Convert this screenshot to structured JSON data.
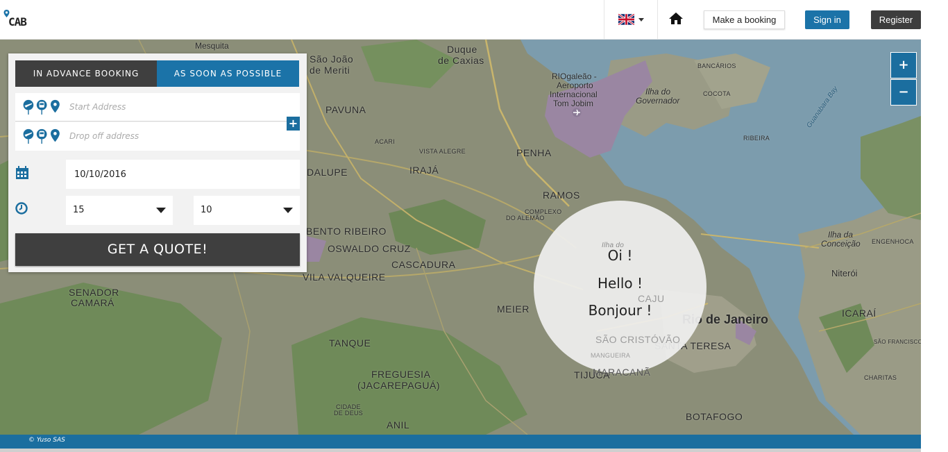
{
  "header": {
    "logo_text": "CAB",
    "language_flag": "uk-flag-icon",
    "home_icon": "home-icon",
    "make_booking_label": "Make a booking",
    "sign_in_label": "Sign in",
    "register_label": "Register",
    "accent_color": "#1b73a8"
  },
  "booking": {
    "tabs": [
      {
        "label": "IN ADVANCE BOOKING",
        "active": false
      },
      {
        "label": "AS SOON AS POSSIBLE",
        "active": true
      }
    ],
    "start_address_placeholder": "Start Address",
    "dropoff_address_placeholder": "Drop off address",
    "address_icons": [
      "plane-icon",
      "train-icon",
      "location-pin-icon"
    ],
    "date_value": "10/10/2016",
    "hour_value": "15",
    "minute_value": "10",
    "quote_label": "GET A QUOTE!"
  },
  "map": {
    "zoom_in_label": "+",
    "zoom_out_label": "−",
    "greetings": [
      "Oi !",
      "Hello !",
      "Bonjour !"
    ],
    "labels": {
      "mesquita": "Mesquita",
      "sao_joao_1": "São João",
      "sao_joao_2": "de Meriti",
      "duque_1": "Duque",
      "duque_2": "de Caxias",
      "galeao_1": "RIOgaleão -",
      "galeao_2": "Aeroporto",
      "galeao_3": "Internacional",
      "galeao_4": "Tom Jobim",
      "ilha_gov_1": "Ilha do",
      "ilha_gov_2": "Governador",
      "bancarios": "BANCÁRIOS",
      "cocota": "COCOTA",
      "ribeira": "RIBEIRA",
      "guanabara_bay": "Guanabara Bay",
      "pavuna": "PAVUNA",
      "acari": "ACARI",
      "vista_alegre": "VISTA ALEGRE",
      "penha": "PENHA",
      "dalupe": "DALUPE",
      "iraja": "IRAJÁ",
      "ramos": "RAMOS",
      "ilha_do": "Ilha do",
      "complexo_1": "COMPLEXO",
      "complexo_2": "DO ALEMÃO",
      "bento_ribeiro": "BENTO RIBEIRO",
      "oswaldo_cruz": "OSWALDO CRUZ",
      "cascadura": "CASCADURA",
      "vila_valqueire": "VILA VALQUEIRE",
      "caju": "CAJU",
      "ilha_conceicao_1": "Ilha da",
      "ilha_conceicao_2": "Conceição",
      "engenhoca": "ENGENHOCA",
      "niteroi": "Niterói",
      "senador_1": "SENADOR",
      "senador_2": "CAMARÁ",
      "meier": "MEIER",
      "sao_cristovao": "SÃO CRISTÓVÃO",
      "mangueira": "MANGUEIRA",
      "rio": "Rio de Janeiro",
      "icarai": "ICARAÍ",
      "maracana": "MARACANÃ",
      "sao_francisco": "SÃO FRANCISCO",
      "tanque": "TANQUE",
      "santa_teresa": "SANTA TERESA",
      "freguesia_1": "FREGUESIA",
      "freguesia_2": "(JACAREPAGUÁ)",
      "tijuca": "TIJUCA",
      "charitas": "CHARITAS",
      "cidade_1": "CIDADE",
      "cidade_2": "DE DEUS",
      "anil": "ANIL",
      "botafogo": "BOTAFOGO"
    }
  },
  "footer": {
    "copyright": "© Yuso SAS"
  }
}
